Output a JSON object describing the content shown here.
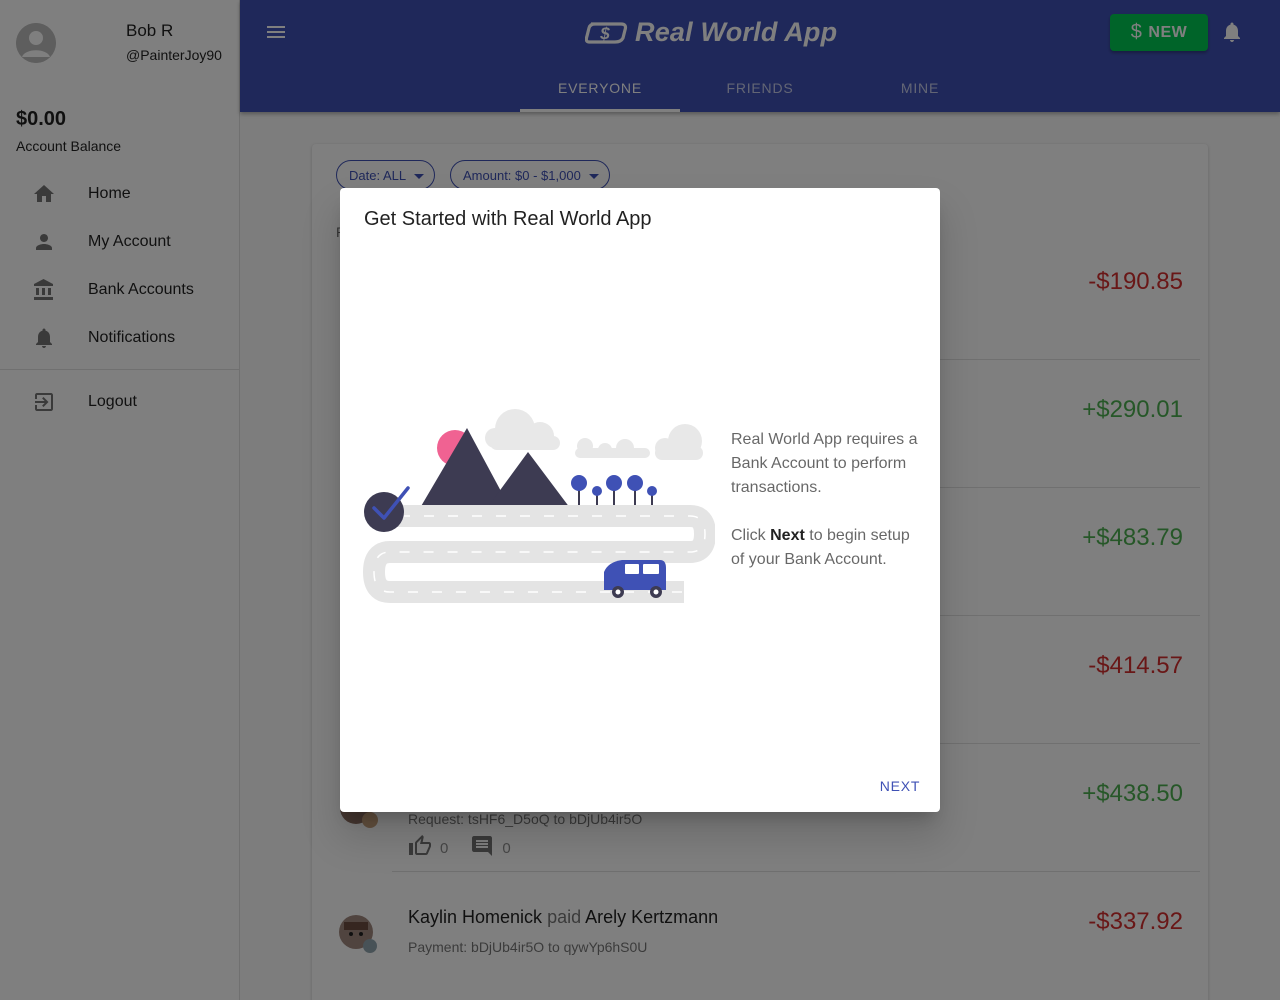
{
  "user": {
    "name": "Bob R",
    "handle": "@PainterJoy90"
  },
  "account": {
    "balance": "$0.00",
    "balance_label": "Account Balance"
  },
  "nav": {
    "items": [
      {
        "label": "Home",
        "icon": "home-icon"
      },
      {
        "label": "My Account",
        "icon": "person-icon"
      },
      {
        "label": "Bank Accounts",
        "icon": "bank-icon"
      },
      {
        "label": "Notifications",
        "icon": "bell-icon"
      }
    ],
    "logout_label": "Logout"
  },
  "header": {
    "app_title": "Real World App",
    "new_button": {
      "symbol": "$",
      "label": "NEW"
    },
    "tabs": [
      "EVERYONE",
      "FRIENDS",
      "MINE"
    ],
    "active_tab": "EVERYONE"
  },
  "filters": {
    "date": "Date: ALL",
    "amount": "Amount: $0 - $1,000"
  },
  "section_letter": "P",
  "transactions": [
    {
      "amount": "-$190.85",
      "sign": "negative"
    },
    {
      "amount": "+$290.01",
      "sign": "positive"
    },
    {
      "amount": "+$483.79",
      "sign": "positive"
    },
    {
      "amount": "-$414.57",
      "sign": "negative"
    },
    {
      "amount": "+$438.50",
      "sign": "positive",
      "subtitle": "Request: tsHF6_D5oQ to bDjUb4ir5O",
      "likes": "0",
      "comments": "0"
    },
    {
      "amount": "-$337.92",
      "sign": "negative",
      "sender": "Kaylin Homenick",
      "action": "paid",
      "receiver": "Arely Kertzmann",
      "subtitle": "Payment: bDjUb4ir5O to qywYp6hS0U"
    }
  ],
  "dialog": {
    "title": "Get Started with Real World App",
    "body_line1": "Real World App requires a Bank Account to perform transactions.",
    "body_click": "Click ",
    "body_bold": "Next",
    "body_rest": " to begin setup of your Bank Account.",
    "next_label": "NEXT"
  },
  "colors": {
    "primary": "#3f51b5",
    "new_button": "#00c853",
    "negative": "#d32f2f",
    "positive": "#4caf50"
  }
}
